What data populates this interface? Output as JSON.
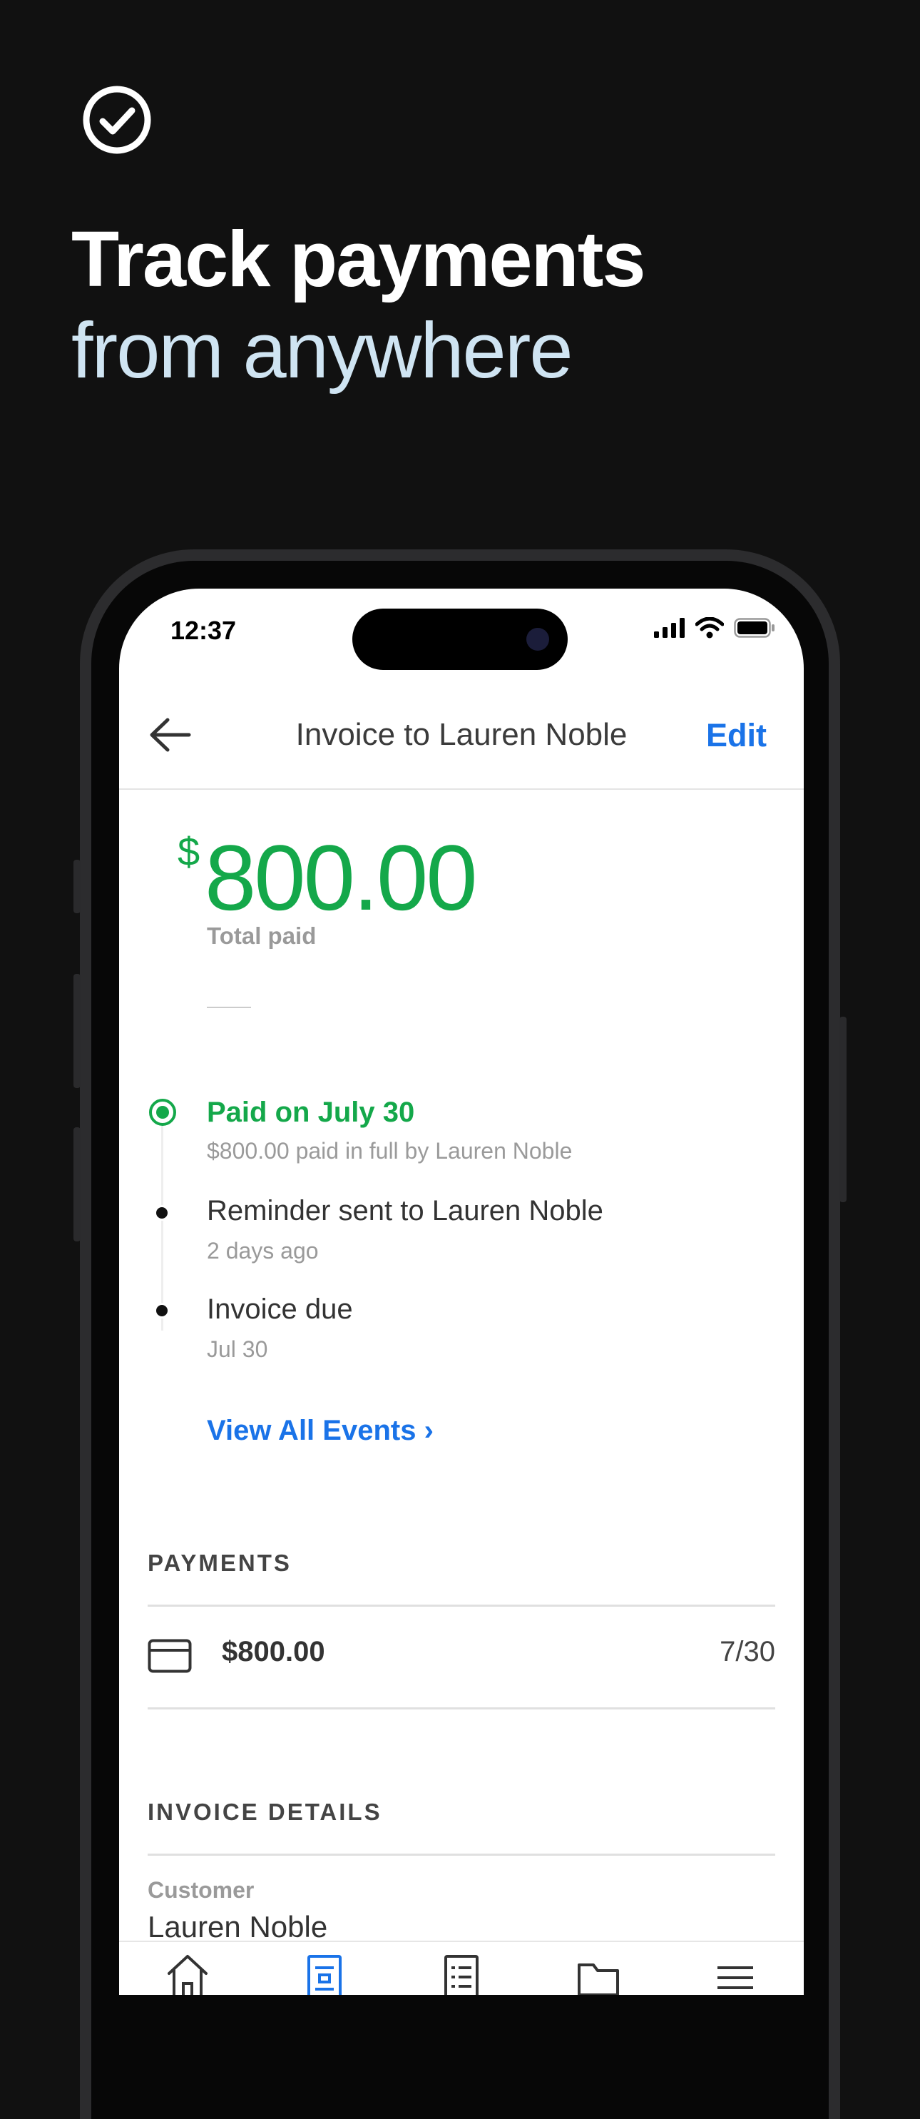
{
  "marketing": {
    "headline_line1": "Track payments",
    "headline_line2": "from anywhere"
  },
  "status_bar": {
    "time": "12:37"
  },
  "nav": {
    "title": "Invoice to Lauren Noble",
    "edit_label": "Edit"
  },
  "summary": {
    "currency_symbol": "$",
    "amount": "800.00",
    "label": "Total paid"
  },
  "timeline": [
    {
      "title": "Paid on July 30",
      "subtitle": "$800.00 paid in full by Lauren Noble",
      "state": "current"
    },
    {
      "title": "Reminder sent to Lauren Noble",
      "subtitle": "2 days ago",
      "state": "past"
    },
    {
      "title": "Invoice due",
      "subtitle": "Jul 30",
      "state": "past"
    }
  ],
  "view_all": "View All Events ›",
  "payments": {
    "header": "PAYMENTS",
    "items": [
      {
        "icon": "credit-card-icon",
        "amount": "$800.00",
        "date": "7/30"
      }
    ]
  },
  "invoice_details": {
    "header": "INVOICE DETAILS",
    "customer_label": "Customer",
    "customer_value": "Lauren Noble"
  },
  "tabbar": {
    "items": [
      {
        "icon": "home-icon",
        "active": false
      },
      {
        "icon": "invoices-icon",
        "active": true
      },
      {
        "icon": "list-icon",
        "active": false
      },
      {
        "icon": "folder-icon",
        "active": false
      },
      {
        "icon": "menu-icon",
        "active": false
      }
    ]
  },
  "colors": {
    "background": "#111111",
    "accent_blue": "#1a73e8",
    "success_green": "#14a84a",
    "subheadline": "#cfe4f2"
  }
}
